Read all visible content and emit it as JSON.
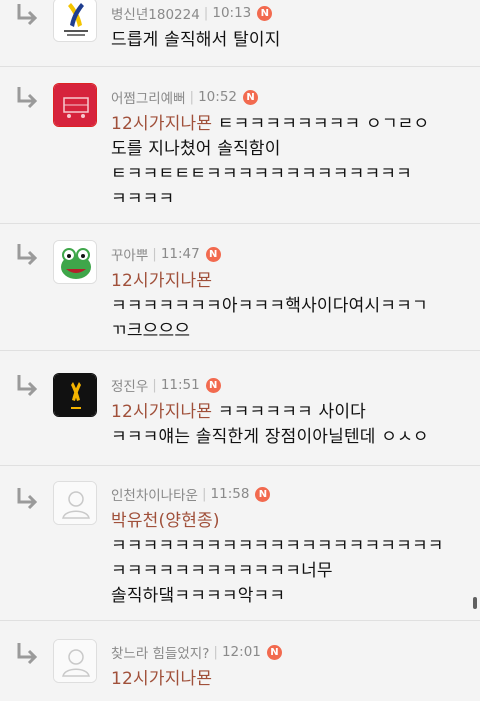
{
  "comments": [
    {
      "author": "병신년180224",
      "time": "10:13",
      "badge": "N",
      "mention": "",
      "text": "드릅게 솔직해서 탈이지"
    },
    {
      "author": "어쩜그리예뻐",
      "time": "10:52",
      "badge": "N",
      "mention": "12시가지나묜",
      "text_line1": " ㅌㅋㅋㅋㅋㅋㅋㅋㅋ ㅇㄱㄹㅇ",
      "text_line2": "도를 지나쳤어 솔직함이",
      "text_line3": "ㅌㅋㅋㅌㅌㅌㅋㅋㅋㅋㅋㅋㅋㅋㅋㅋㅋㅋㅋ",
      "text_line4": "ㅋㅋㅋㅋ"
    },
    {
      "author": "꾸아뿌",
      "time": "11:47",
      "badge": "N",
      "mention": "12시가지나묜",
      "text_line1": "ㅋㅋㅋㅋㅋㅋㅋ아ㅋㅋㅋ핵사이다여시ㅋㅋㄱ",
      "text_line2": "ㄲ크으으으"
    },
    {
      "author": "정진우",
      "time": "11:51",
      "badge": "N",
      "mention": "12시가지나묜",
      "text_line1": " ㅋㅋㅋㅋㅋㅋ 사이다",
      "text_line2": "ㅋㅋㅋ얘는 솔직한게 장점이아닐텐데 ㅇㅅㅇ"
    },
    {
      "author": "인천차이나타운",
      "time": "11:58",
      "badge": "N",
      "mention": "박유천(양현종)",
      "text_line1": "ㅋㅋㅋㅋㅋㅋㅋㅋㅋㅋㅋㅋㅋㅋㅋㅋㅋㅋㅋㅋㅋ",
      "text_line2": "ㅋㅋㅋㅋㅋㅋㅋㅋㅋㅋㅋㅋ너무",
      "text_line3": "솔직하댘ㅋㅋㅋㅋ악ㅋㅋ"
    },
    {
      "author": "찾느라 힘들었지?",
      "time": "12:01",
      "badge": "N",
      "mention": "12시가지나묜",
      "text": ""
    }
  ],
  "icons": {
    "reply": "reply-arrow-icon",
    "new": "new-badge-icon"
  },
  "colors": {
    "mention": "#a0503a",
    "badge": "#f26a4f",
    "background": "#f4f4f4"
  }
}
